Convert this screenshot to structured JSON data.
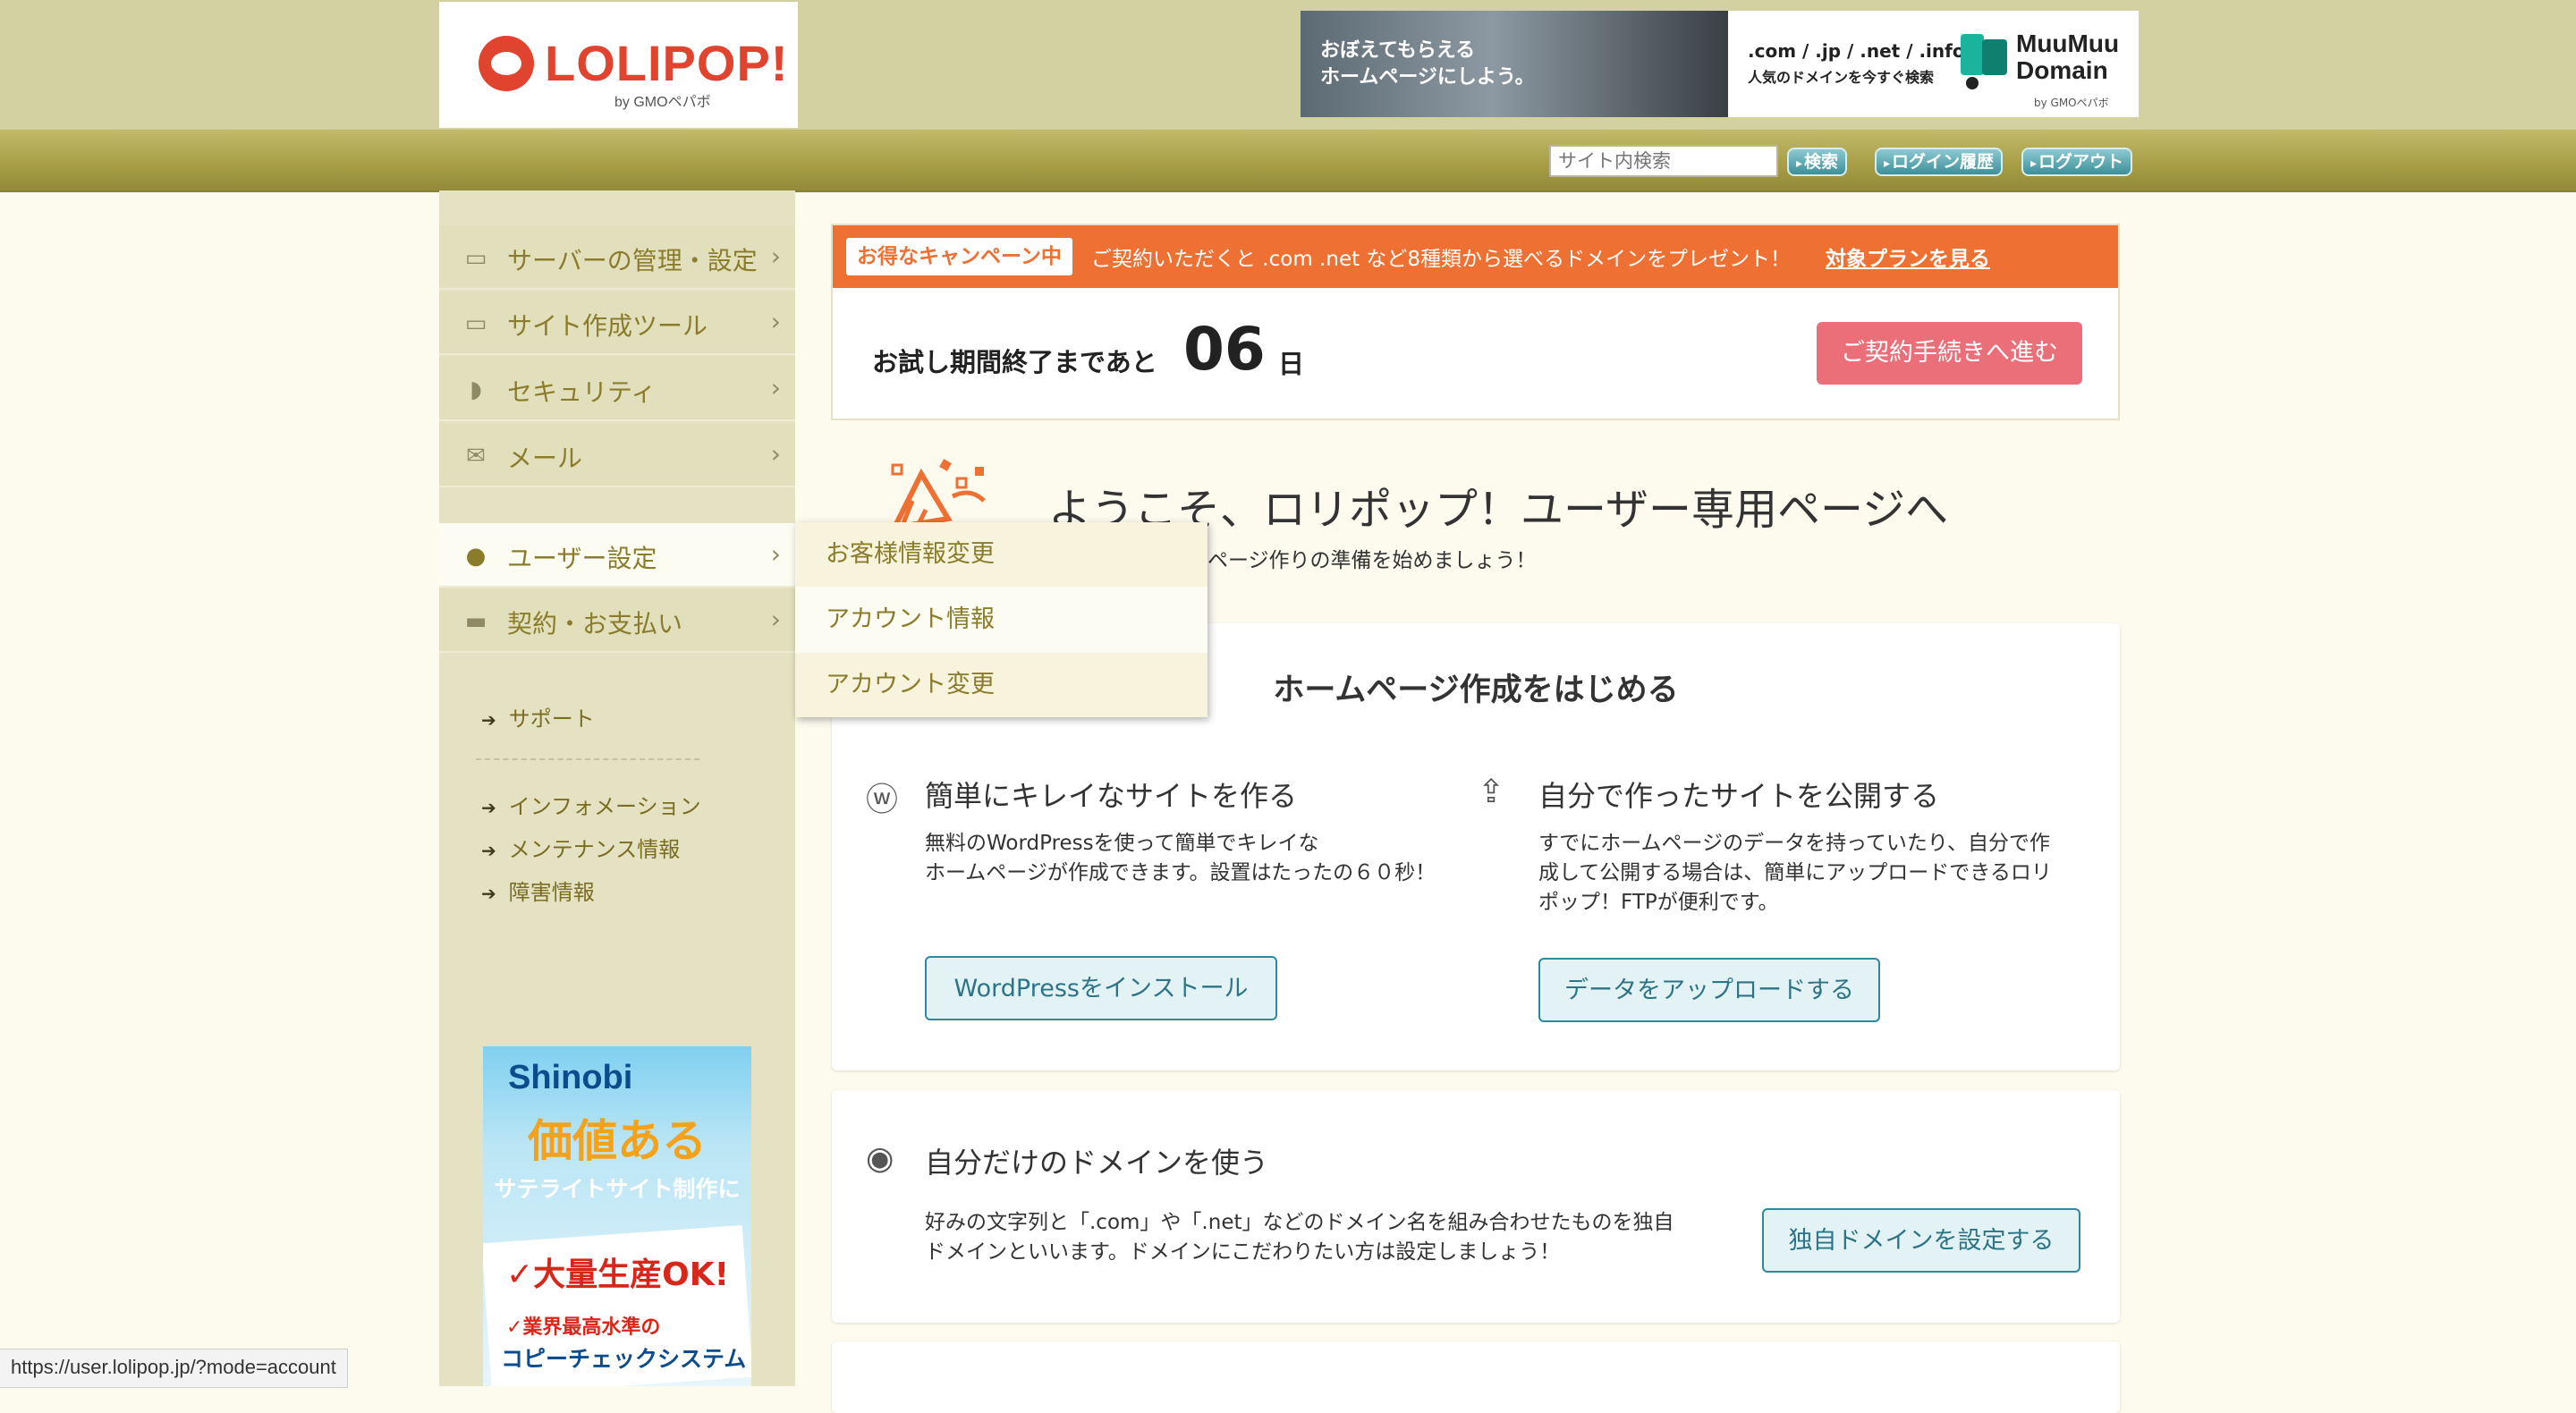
{
  "header": {
    "logo_text": "LOLIPOP!",
    "logo_sub": "by GMOペパボ",
    "banner": {
      "photo_line1": "おぼえてもらえる",
      "photo_line2": "ホームページにしよう。",
      "tlds": ".com / .jp / .net / .info",
      "tagline": "人気のドメインを今すぐ検索",
      "brand_line1": "MuuMuu",
      "brand_line2": "Domain",
      "brand_sub": "by GMOペパボ"
    }
  },
  "toolbar": {
    "search_placeholder": "サイト内検索",
    "search_button": "検索",
    "login_history_button": "ログイン履歴",
    "logout_button": "ログアウト"
  },
  "sidebar": {
    "menu": [
      {
        "label": "サーバーの管理・設定",
        "icon": "server-icon"
      },
      {
        "label": "サイト作成ツール",
        "icon": "laptop-icon"
      },
      {
        "label": "セキュリティ",
        "icon": "shield-icon"
      },
      {
        "label": "メール",
        "icon": "mail-icon"
      },
      {
        "label": "ユーザー設定",
        "icon": "user-icon"
      },
      {
        "label": "契約・お支払い",
        "icon": "credit-card-icon"
      }
    ],
    "support_link": "サポート",
    "info_links": [
      "インフォメーション",
      "メンテナンス情報",
      "障害情報"
    ],
    "ad": {
      "brand": "Shinobi",
      "headline": "価値ある",
      "subline": "サテライトサイト制作に",
      "point1": "✓大量生産OK!",
      "point2": "✓業界最高水準の",
      "point3": "コピーチェックシステム"
    }
  },
  "dropdown": {
    "items": [
      "お客様情報変更",
      "アカウント情報",
      "アカウント変更"
    ]
  },
  "campaign": {
    "tag": "お得なキャンペーン中",
    "text": "ご契約いただくと .com .net など8種類から選べるドメインをプレゼント！",
    "link": "対象プランを見る",
    "trial_label": "お試し期間終了まであと",
    "trial_days": "06",
    "trial_unit": "日",
    "contract_button": "ご契約手続きへ進む"
  },
  "welcome": {
    "title": "ようこそ、ロリポップ！ユーザー専用ページへ",
    "subtitle": "ページ作りの準備を始めましょう！"
  },
  "start_card": {
    "title": "ホームページ作成をはじめる",
    "left": {
      "title": "簡単にキレイなサイトを作る",
      "desc_line1": "無料のWordPressを使って簡単でキレイな",
      "desc_line2": "ホームページが作成できます。設置はたったの６０秒！",
      "button": "WordPressをインストール"
    },
    "right": {
      "title": "自分で作ったサイトを公開する",
      "desc_line1": "すでにホームページのデータを持っていたり、自分で作",
      "desc_line2": "成して公開する場合は、簡単にアップロードできるロリ",
      "desc_line3": "ポップ！FTPが便利です。",
      "button": "データをアップロードする"
    }
  },
  "domain_card": {
    "title": "自分だけのドメインを使う",
    "desc_line1": "好みの文字列と「.com」や「.net」などのドメイン名を組み合わせたものを独自",
    "desc_line2": "ドメインといいます。ドメインにこだわりたい方は設定しましょう！",
    "button": "独自ドメインを設定する"
  },
  "status_bar": {
    "url": "https://user.lolipop.jp/?mode=account"
  },
  "colors": {
    "header_band": "#d3d0a2",
    "nav_band": "#a69d45",
    "sidebar": "#e5e2c4",
    "campaign_orange": "#ee7032",
    "contract_pink": "#ea6f79",
    "button_teal": "#2c8aa0"
  }
}
